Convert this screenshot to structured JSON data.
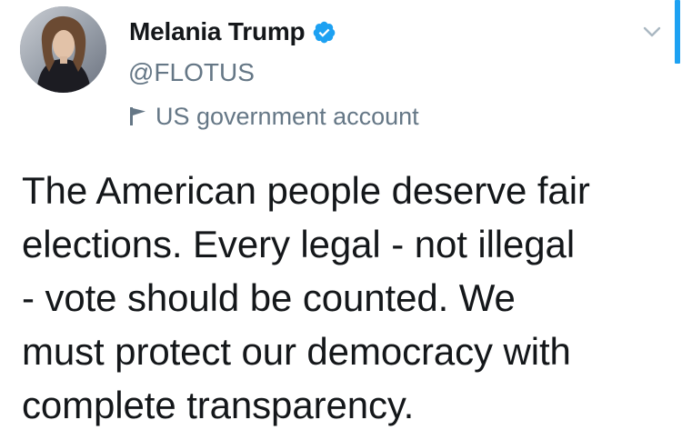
{
  "author": {
    "display_name": "Melania Trump",
    "handle": "@FLOTUS",
    "verified": true,
    "account_label": "US government account"
  },
  "tweet": {
    "text": "The American people deserve fair\nelections. Every legal - not illegal\n- vote should be counted. We\nmust protect our democracy with\ncomplete transparency."
  },
  "icons": {
    "verified": "verified-badge-icon",
    "government_flag": "flag-icon",
    "more_options": "chevron-down-icon"
  },
  "colors": {
    "text_primary": "#14171a",
    "text_secondary": "#657786",
    "accent": "#1da1f2"
  }
}
